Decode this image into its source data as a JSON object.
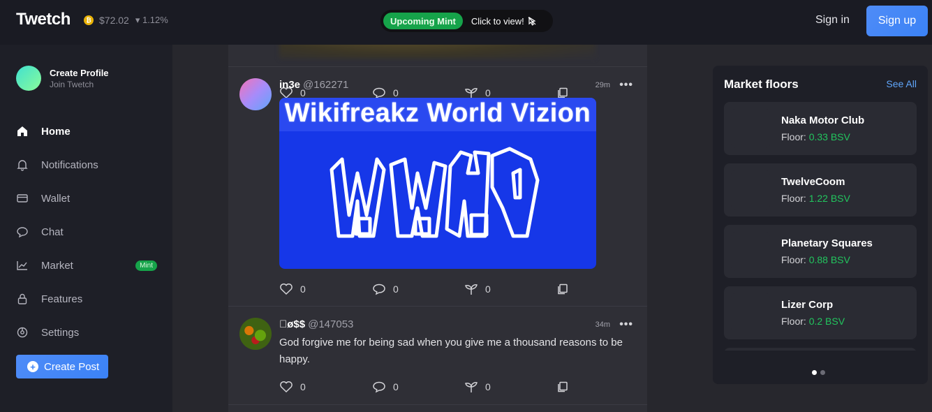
{
  "header": {
    "logo": "Twetch",
    "bsv_price": "$72.02",
    "bsv_change": "▾ 1.12%",
    "mint_badge": "Upcoming Mint",
    "mint_cta": "Click to view!",
    "sign_in": "Sign in",
    "sign_up": "Sign up"
  },
  "sidebar": {
    "profile_title": "Create Profile",
    "profile_sub": "Join Twetch",
    "items": [
      {
        "label": "Home",
        "icon": "home-icon"
      },
      {
        "label": "Notifications",
        "icon": "bell-icon"
      },
      {
        "label": "Wallet",
        "icon": "wallet-icon"
      },
      {
        "label": "Chat",
        "icon": "chat-icon"
      },
      {
        "label": "Market",
        "icon": "chart-icon",
        "badge": "Mint"
      },
      {
        "label": "Features",
        "icon": "lock-icon"
      },
      {
        "label": "Settings",
        "icon": "settings-icon"
      }
    ],
    "create_post": "Create Post"
  },
  "feed": {
    "posts": [
      {
        "likes": "0",
        "comments": "0",
        "branches": "0"
      },
      {
        "username": "in3e",
        "handle": "@162271",
        "time": "29m",
        "image_title": "Wikifreakz World Vizion",
        "likes": "0",
        "comments": "0",
        "branches": "0"
      },
      {
        "username": "\u0000ø$$",
        "handle": "@147053",
        "time": "34m",
        "text": "God forgive me for being sad when you give me a thousand reasons to be happy.",
        "likes": "0",
        "comments": "0",
        "branches": "0"
      }
    ],
    "more_glyph": "•••"
  },
  "market": {
    "title": "Market floors",
    "see_all": "See All",
    "floor_label": "Floor:",
    "cards": [
      {
        "name": "Naka Motor Club",
        "floor": "0.33 BSV"
      },
      {
        "name": "TwelveCoom",
        "floor": "1.22 BSV"
      },
      {
        "name": "Planetary Squares",
        "floor": "0.88 BSV"
      },
      {
        "name": "Lizer Corp",
        "floor": "0.2 BSV"
      }
    ]
  },
  "colors": {
    "accent": "#3b82f6",
    "mint_green": "#16a34a",
    "floor_green": "#22c55e",
    "link_blue": "#60a5fa"
  }
}
